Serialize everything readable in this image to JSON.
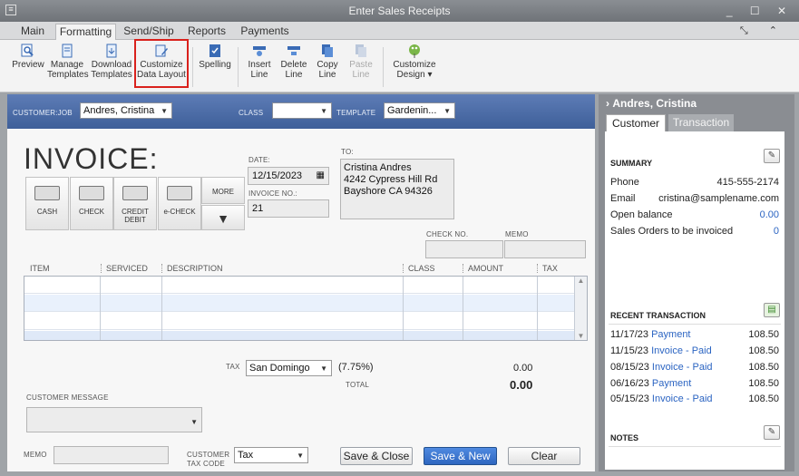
{
  "window": {
    "title": "Enter Sales Receipts",
    "sys_icon": "window-menu-icon",
    "controls": "_ ☐ ✕"
  },
  "tabs": [
    {
      "label": "Main"
    },
    {
      "label": "Formatting"
    },
    {
      "label": "Send/Ship"
    },
    {
      "label": "Reports"
    },
    {
      "label": "Payments"
    }
  ],
  "ribbon": {
    "preview": "Preview",
    "manage": "Manage Templates",
    "download": "Download Templates",
    "customize_layout": "Customize Data Layout",
    "spelling": "Spelling",
    "insert_line": "Insert Line",
    "delete_line": "Delete Line",
    "copy_line": "Copy Line",
    "paste_line": "Paste Line",
    "customize_design": "Customize Design ▾"
  },
  "header": {
    "customer_job_label": "CUSTOMER:JOB",
    "customer_job_value": "Andres, Cristina",
    "class_label": "CLASS",
    "class_value": "",
    "template_label": "TEMPLATE",
    "template_value": "Gardenin..."
  },
  "form": {
    "title": "INVOICE:",
    "payment_methods": [
      {
        "label": "CASH"
      },
      {
        "label": "CHECK"
      },
      {
        "label": "CREDIT DEBIT"
      },
      {
        "label": "e-CHECK"
      }
    ],
    "more_label": "MORE",
    "date_label": "DATE:",
    "date_value": "12/15/2023",
    "invoice_no_label": "INVOICE NO.:",
    "invoice_no_value": "21",
    "to_label": "TO:",
    "to_lines": [
      "Cristina Andres",
      "4242 Cypress Hill Rd",
      "Bayshore CA 94326"
    ],
    "check_no_label": "CHECK NO.",
    "memo_top_label": "MEMO",
    "columns": [
      "ITEM",
      "SERVICED",
      "DESCRIPTION",
      "CLASS",
      "AMOUNT",
      "TAX"
    ],
    "tax_label": "TAX",
    "tax_value": "San Domingo",
    "tax_rate": "(7.75%)",
    "tax_amount": "0.00",
    "total_label": "TOTAL",
    "total_value": "0.00",
    "customer_message_label": "CUSTOMER MESSAGE",
    "memo_label": "MEMO",
    "customer_tax_code_label": "CUSTOMER TAX CODE",
    "tax_code_value": "Tax",
    "save_close": "Save & Close",
    "save_new": "Save & New",
    "clear": "Clear"
  },
  "sidebar": {
    "name": "Andres, Cristina",
    "tabs": [
      {
        "label": "Customer"
      },
      {
        "label": "Transaction"
      }
    ],
    "summary_title": "SUMMARY",
    "summary": [
      {
        "label": "Phone",
        "value": "415-555-2174"
      },
      {
        "label": "Email",
        "value": "cristina@samplename.com"
      },
      {
        "label": "Open balance",
        "value": "0.00"
      },
      {
        "label": "Sales Orders to be invoiced",
        "value": "0"
      }
    ],
    "recent_title": "RECENT TRANSACTION",
    "recent": [
      {
        "date": "11/17/23",
        "type": "Payment",
        "status": "",
        "amount": "108.50"
      },
      {
        "date": "11/15/23",
        "type": "Invoice",
        "status": " - Paid",
        "amount": "108.50"
      },
      {
        "date": "08/15/23",
        "type": "Invoice",
        "status": " - Paid",
        "amount": "108.50"
      },
      {
        "date": "06/16/23",
        "type": "Payment",
        "status": "",
        "amount": "108.50"
      },
      {
        "date": "05/15/23",
        "type": "Invoice",
        "status": " - Paid",
        "amount": "108.50"
      }
    ],
    "notes_title": "NOTES"
  },
  "colors": {
    "accent": "#3e5f99",
    "highlight": "#d9211c",
    "link": "#2b64c2"
  }
}
